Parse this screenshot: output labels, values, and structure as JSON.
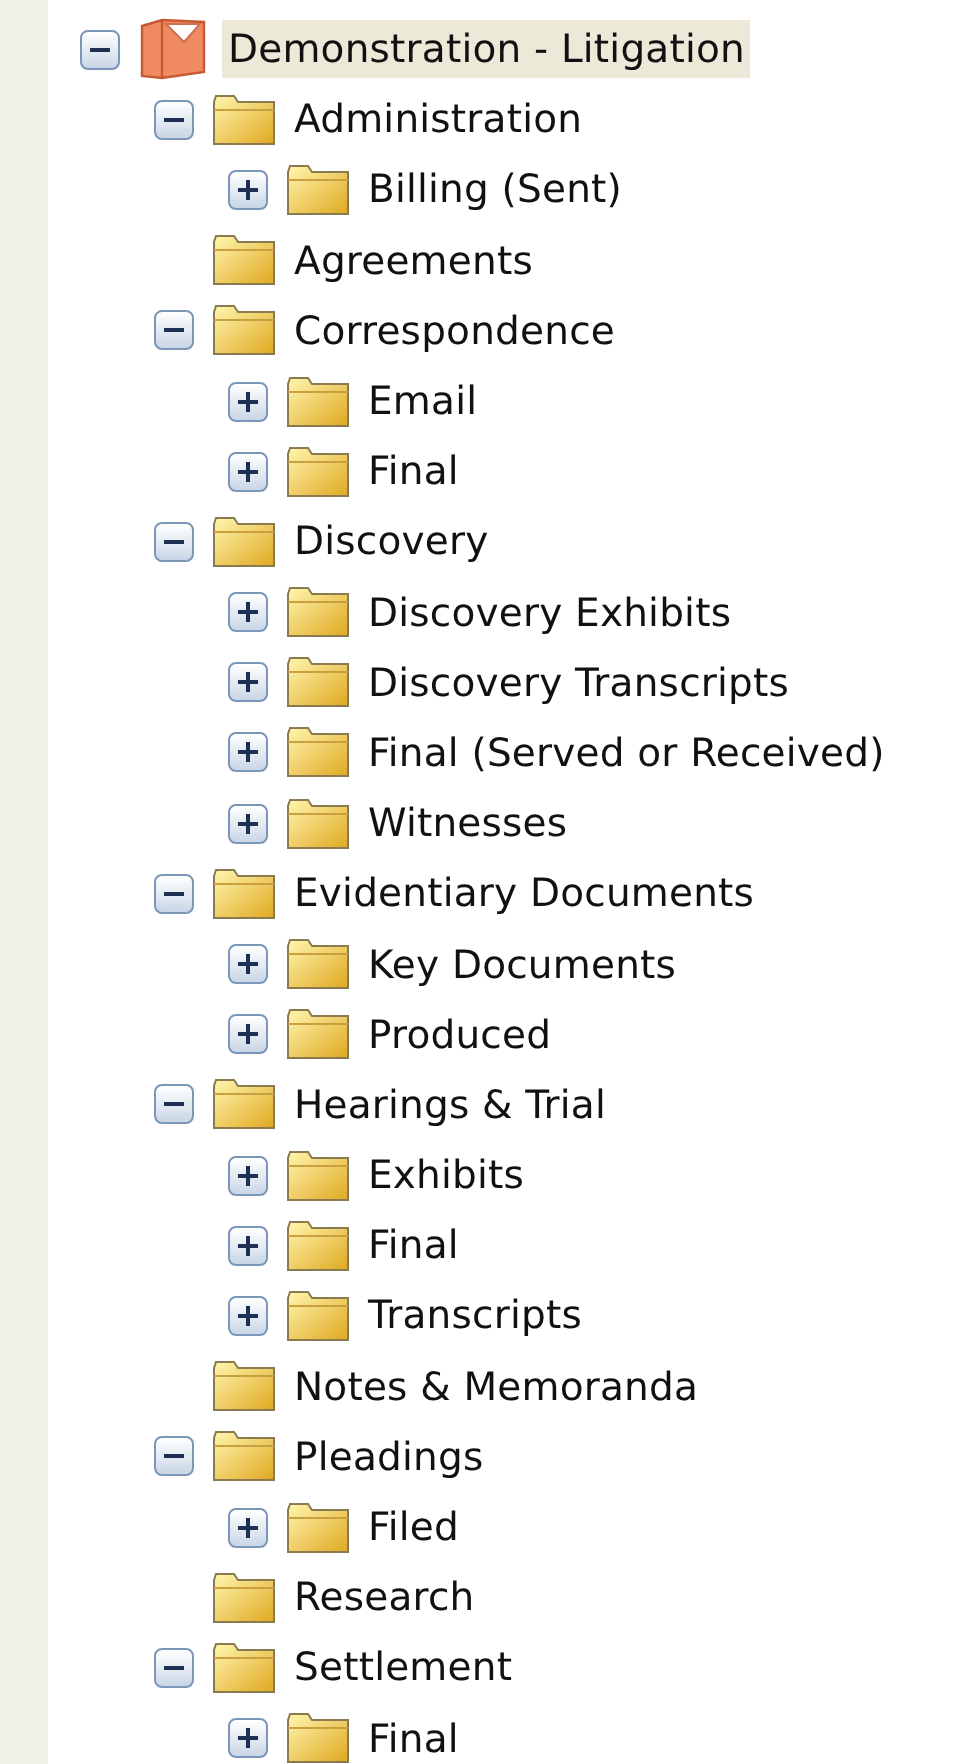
{
  "tree": {
    "label": "Demonstration - Litigation",
    "kind": "binder",
    "selected": true,
    "expanded": true,
    "children": [
      {
        "label": "Administration",
        "kind": "folder",
        "selected": false,
        "expanded": true,
        "children": [
          {
            "label": "Billing (Sent)",
            "kind": "folder",
            "selected": false,
            "expanded": false
          }
        ]
      },
      {
        "label": "Agreements",
        "kind": "folder",
        "selected": false
      },
      {
        "label": "Correspondence",
        "kind": "folder",
        "selected": false,
        "expanded": true,
        "children": [
          {
            "label": "Email",
            "kind": "folder",
            "selected": false,
            "expanded": false
          },
          {
            "label": "Final",
            "kind": "folder",
            "selected": false,
            "expanded": false
          }
        ]
      },
      {
        "label": "Discovery",
        "kind": "folder",
        "selected": false,
        "expanded": true,
        "children": [
          {
            "label": "Discovery Exhibits",
            "kind": "folder",
            "selected": false,
            "expanded": false
          },
          {
            "label": "Discovery Transcripts",
            "kind": "folder",
            "selected": false,
            "expanded": false
          },
          {
            "label": "Final (Served or Received)",
            "kind": "folder",
            "selected": false,
            "expanded": false
          },
          {
            "label": "Witnesses",
            "kind": "folder",
            "selected": false,
            "expanded": false
          }
        ]
      },
      {
        "label": "Evidentiary Documents",
        "kind": "folder",
        "selected": false,
        "expanded": true,
        "children": [
          {
            "label": "Key Documents",
            "kind": "folder",
            "selected": false,
            "expanded": false
          },
          {
            "label": "Produced",
            "kind": "folder",
            "selected": false,
            "expanded": false
          }
        ]
      },
      {
        "label": "Hearings & Trial",
        "kind": "folder",
        "selected": false,
        "expanded": true,
        "children": [
          {
            "label": "Exhibits",
            "kind": "folder",
            "selected": false,
            "expanded": false
          },
          {
            "label": "Final",
            "kind": "folder",
            "selected": false,
            "expanded": false
          },
          {
            "label": "Transcripts",
            "kind": "folder",
            "selected": false,
            "expanded": false
          }
        ]
      },
      {
        "label": "Notes & Memoranda",
        "kind": "folder",
        "selected": false
      },
      {
        "label": "Pleadings",
        "kind": "folder",
        "selected": false,
        "expanded": true,
        "children": [
          {
            "label": "Filed",
            "kind": "folder",
            "selected": false,
            "expanded": false
          }
        ]
      },
      {
        "label": "Research",
        "kind": "folder",
        "selected": false
      },
      {
        "label": "Settlement",
        "kind": "folder",
        "selected": false,
        "expanded": true,
        "children": [
          {
            "label": "Final",
            "kind": "folder",
            "selected": false,
            "expanded": false
          }
        ]
      }
    ]
  }
}
